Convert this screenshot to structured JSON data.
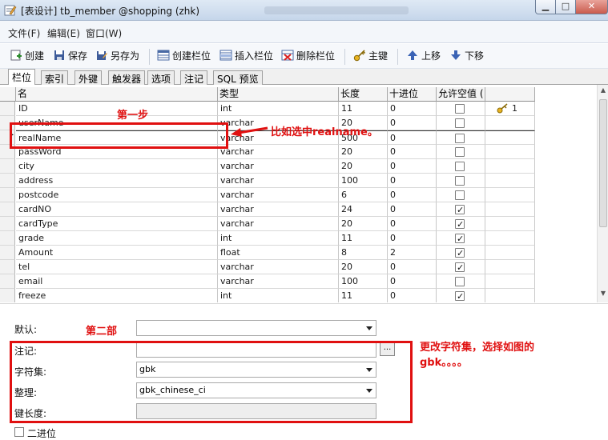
{
  "window": {
    "title": "[表设计] tb_member @shopping (zhk)",
    "minimize": "▁",
    "maximize": "□",
    "close": "✕"
  },
  "menu": [
    "文件(F)",
    "编辑(E)",
    "窗口(W)"
  ],
  "toolbar": {
    "create": "创建",
    "save": "保存",
    "save_as": "另存为",
    "create_field": "创建栏位",
    "insert_field": "插入栏位",
    "delete_field": "删除栏位",
    "primary_key": "主键",
    "move_up": "上移",
    "move_down": "下移"
  },
  "tabs": [
    "栏位",
    "索引",
    "外键",
    "触发器",
    "选项",
    "注记",
    "SQL 预览"
  ],
  "grid": {
    "headers": [
      "名",
      "类型",
      "长度",
      "十进位",
      "允许空值 ("
    ],
    "rows": [
      {
        "name": "ID",
        "type": "int",
        "length": "11",
        "decimal": "0",
        "nullable": false,
        "key": "1"
      },
      {
        "name": "userName",
        "type": "varchar",
        "length": "20",
        "decimal": "0",
        "nullable": false,
        "key": ""
      },
      {
        "name": "realName",
        "type": "varchar",
        "length": "500",
        "decimal": "0",
        "nullable": false,
        "key": ""
      },
      {
        "name": "passWord",
        "type": "varchar",
        "length": "20",
        "decimal": "0",
        "nullable": false,
        "key": ""
      },
      {
        "name": "city",
        "type": "varchar",
        "length": "20",
        "decimal": "0",
        "nullable": false,
        "key": ""
      },
      {
        "name": "address",
        "type": "varchar",
        "length": "100",
        "decimal": "0",
        "nullable": false,
        "key": ""
      },
      {
        "name": "postcode",
        "type": "varchar",
        "length": "6",
        "decimal": "0",
        "nullable": false,
        "key": ""
      },
      {
        "name": "cardNO",
        "type": "varchar",
        "length": "24",
        "decimal": "0",
        "nullable": true,
        "key": ""
      },
      {
        "name": "cardType",
        "type": "varchar",
        "length": "20",
        "decimal": "0",
        "nullable": true,
        "key": ""
      },
      {
        "name": "grade",
        "type": "int",
        "length": "11",
        "decimal": "0",
        "nullable": true,
        "key": ""
      },
      {
        "name": "Amount",
        "type": "float",
        "length": "8",
        "decimal": "2",
        "nullable": true,
        "key": ""
      },
      {
        "name": "tel",
        "type": "varchar",
        "length": "20",
        "decimal": "0",
        "nullable": true,
        "key": ""
      },
      {
        "name": "email",
        "type": "varchar",
        "length": "100",
        "decimal": "0",
        "nullable": false,
        "key": ""
      },
      {
        "name": "freeze",
        "type": "int",
        "length": "11",
        "decimal": "0",
        "nullable": true,
        "key": ""
      }
    ]
  },
  "props": {
    "default_label": "默认:",
    "comment_label": "注记:",
    "charset_label": "字符集:",
    "charset_value": "gbk",
    "collation_label": "整理:",
    "collation_value": "gbk_chinese_ci",
    "key_length_label": "键长度:",
    "binary_label": "二进位",
    "ellipsis": "..."
  },
  "annotations": {
    "step1": "第一步",
    "select_hint": "比如选中realname。",
    "step2": "第二部",
    "change_hint_line1": "更改字符集，选择如图的",
    "change_hint_line2": "gbk。。。。"
  },
  "colors": {
    "annotation": "#e01010"
  }
}
